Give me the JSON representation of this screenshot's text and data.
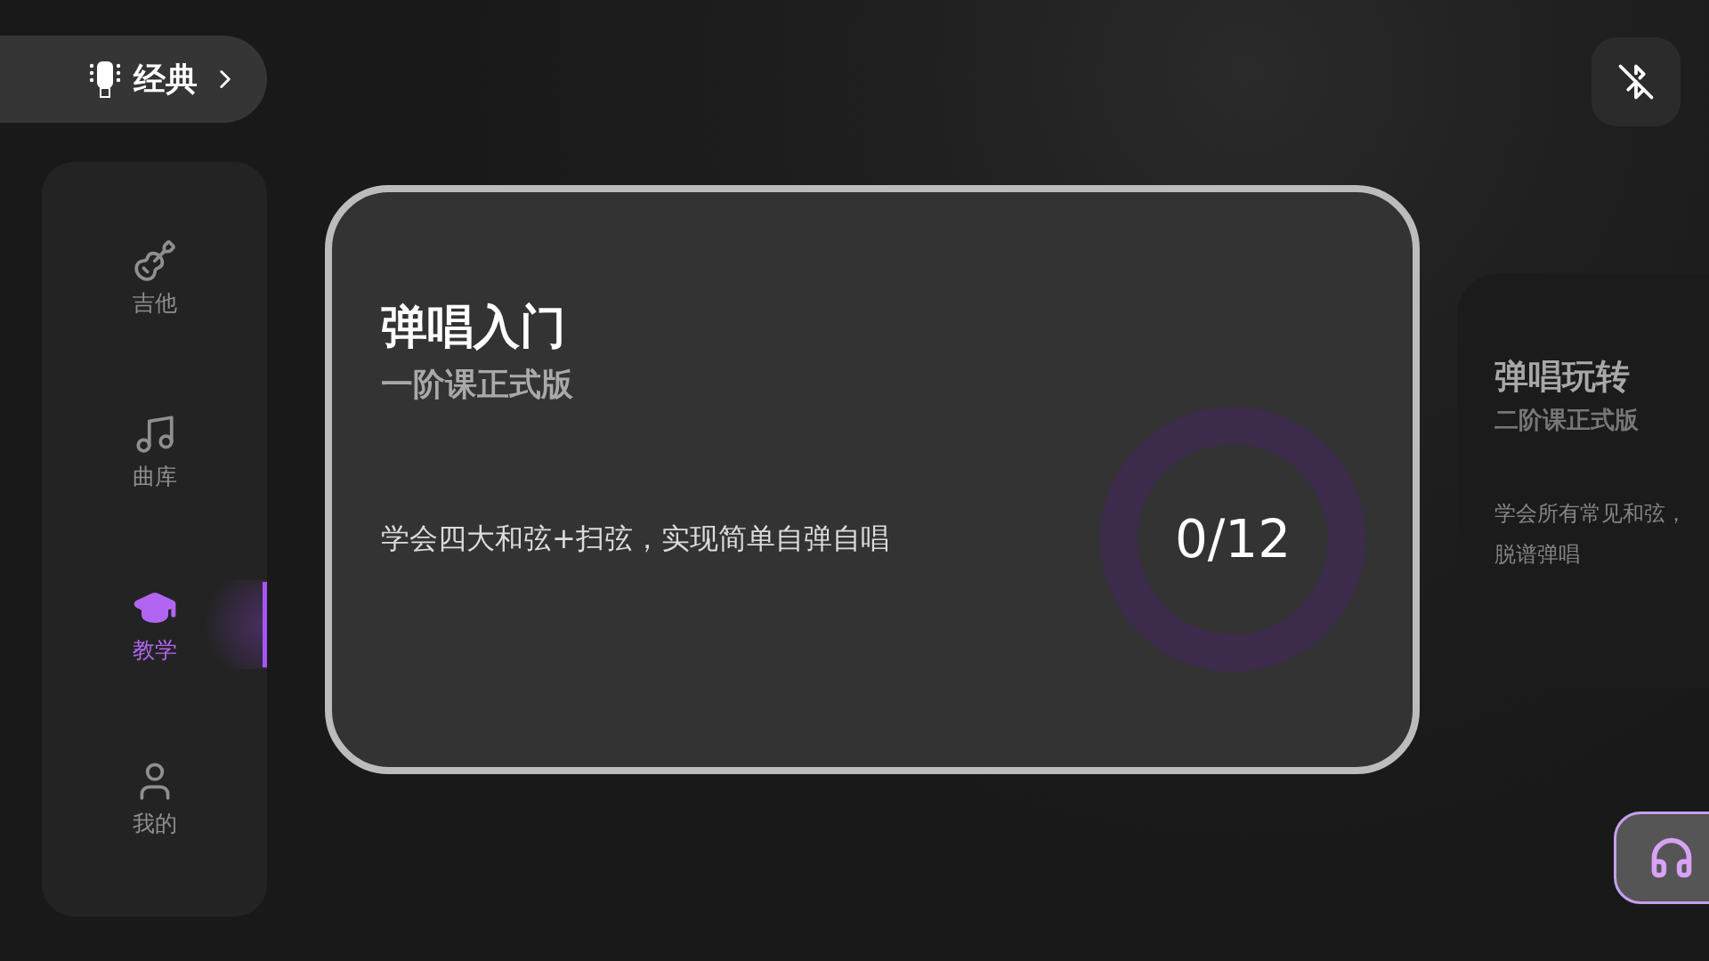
{
  "mode_switch": {
    "label": "经典"
  },
  "sidebar": {
    "items": [
      {
        "kind": "guitar",
        "label": "吉他",
        "selected": false
      },
      {
        "kind": "music",
        "label": "曲库",
        "selected": false
      },
      {
        "kind": "teaching",
        "label": "教学",
        "selected": true
      },
      {
        "kind": "profile",
        "label": "我的",
        "selected": false
      }
    ]
  },
  "courses": [
    {
      "title": "弹唱入门",
      "subtitle": "一阶课正式版",
      "description": [
        "学会四大和弦+扫弦，实现简单自弹自唱"
      ],
      "progress": {
        "reading": "0/12",
        "level": 0
      },
      "selected": true
    },
    {
      "title": "弹唱玩转",
      "subtitle": "二阶课正式版",
      "description": [
        "学会所有常见和弦，",
        "脱谱弹唱"
      ],
      "selected": false
    }
  ]
}
